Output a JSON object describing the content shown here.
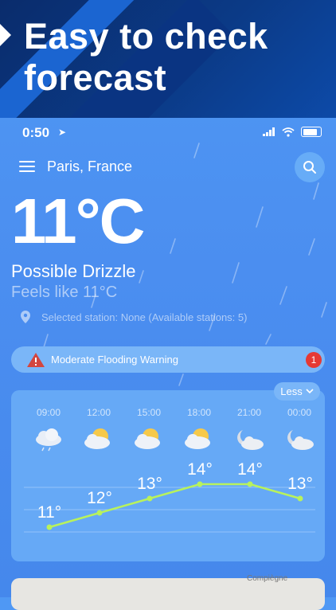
{
  "banner": {
    "line1": "Easy to check",
    "line2": "forecast"
  },
  "status": {
    "time": "0:50"
  },
  "header": {
    "city": "Paris, France"
  },
  "current": {
    "temperature": "11°C",
    "condition": "Possible Drizzle",
    "feels_like": "Feels like 11°C",
    "station": "Selected station: None (Available stations: 5)"
  },
  "warning": {
    "text": "Moderate Flooding Warning",
    "count": "1"
  },
  "forecast": {
    "toggle_label": "Less",
    "hours": [
      "09:00",
      "12:00",
      "15:00",
      "18:00",
      "21:00",
      "00:00"
    ],
    "icons": [
      "drizzle-cloud-icon",
      "partly-sunny-icon",
      "partly-sunny-icon",
      "partly-sunny-icon",
      "moon-cloud-icon",
      "moon-cloud-icon"
    ],
    "temps": [
      "11°",
      "12°",
      "13°",
      "14°",
      "14°",
      "13°"
    ]
  },
  "chart_data": {
    "type": "line",
    "categories": [
      "09:00",
      "12:00",
      "15:00",
      "18:00",
      "21:00",
      "00:00"
    ],
    "series": [
      {
        "values": [
          11,
          12,
          13,
          14,
          14,
          13
        ]
      }
    ],
    "ylim": [
      10,
      15
    ]
  },
  "map": {
    "town_label": "Compiègne"
  },
  "colors": {
    "background": "#4b8ef0",
    "banner": "#0b3a86",
    "line": "#b8f25c",
    "alert": "#e53935"
  }
}
